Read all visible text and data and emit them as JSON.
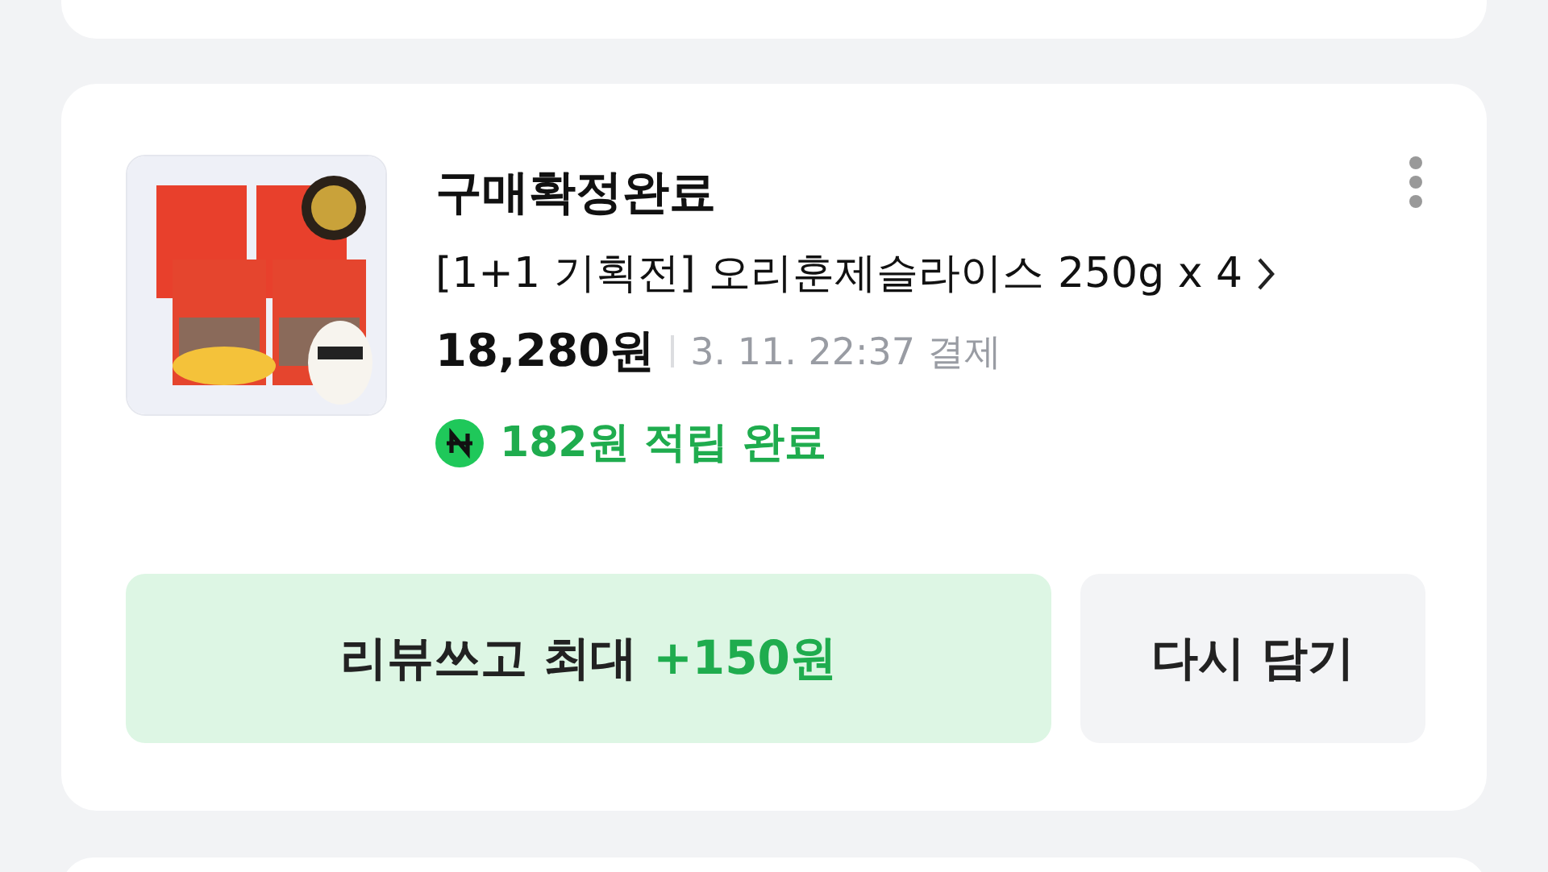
{
  "order": {
    "status": "구매확정완료",
    "product_name": "[1+1 기획전] 오리훈제슬라이스 250g x 4",
    "price": "18,280원",
    "paid_at": "3. 11. 22:37 결제",
    "points": "182원 적립 완료",
    "buttons": [
      {
        "kind": "review",
        "label": "리뷰쓰고 최대",
        "reward": "+150원"
      },
      {
        "kind": "plain",
        "label": "다시 담기"
      }
    ]
  }
}
